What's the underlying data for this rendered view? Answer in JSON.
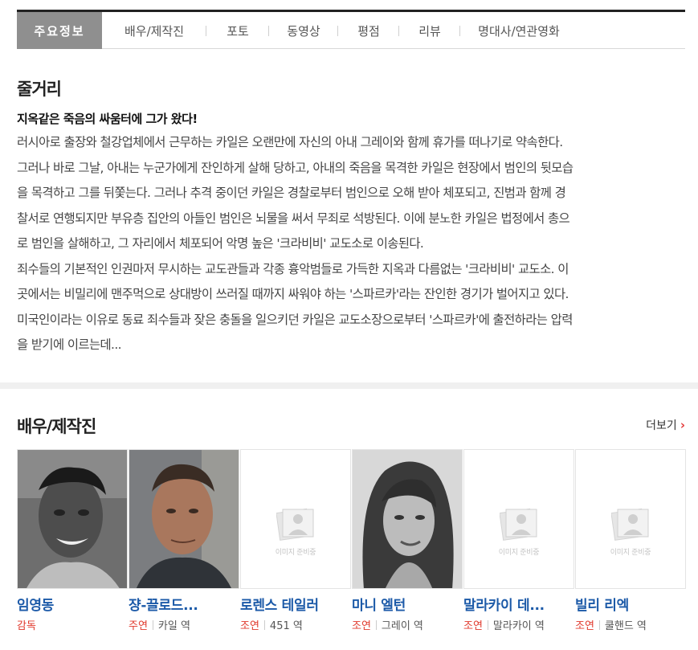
{
  "tabs": [
    {
      "label": "주요정보",
      "active": true
    },
    {
      "label": "배우/제작진"
    },
    {
      "label": "포토"
    },
    {
      "label": "동영상"
    },
    {
      "label": "평점"
    },
    {
      "label": "리뷰"
    },
    {
      "label": "명대사/연관영화"
    }
  ],
  "synopsis": {
    "title": "줄거리",
    "headline": "지옥같은 죽음의 싸움터에 그가 왔다!",
    "lines": [
      "러시아로 출장와 철강업체에서 근무하는 카일은 오랜만에 자신의 아내 그레이와 함께 휴가를 떠나기로 약속한다.",
      "그러나 바로 그날, 아내는 누군가에게 잔인하게 살해 당하고, 아내의 죽음을 목격한 카일은 현장에서 범인의 뒷모습",
      "을 목격하고 그를 뒤쫓는다. 그러나 추격 중이던 카일은 경찰로부터 범인으로 오해 받아 체포되고, 진범과 함께 경",
      "찰서로 연행되지만 부유층 집안의 아들인 범인은 뇌물을 써서 무죄로 석방된다. 이에 분노한 카일은 법정에서 총으",
      "로 범인을 살해하고, 그 자리에서 체포되어 악명 높은 '크라비비' 교도소로 이송된다.",
      "  죄수들의 기본적인 인권마저 무시하는 교도관들과 각종 흉악범들로 가득한 지옥과 다름없는 '크라비비' 교도소. 이",
      "곳에서는 비밀리에 맨주먹으로 상대방이 쓰러질 때까지 싸워야 하는 '스파르카'라는 잔인한 경기가 벌어지고 있다.",
      "미국인이라는 이유로 동료 죄수들과 잦은 충돌을 일으키던 카일은 교도소장으로부터 '스파르카'에 출전하라는 압력",
      "을 받기에 이르는데..."
    ]
  },
  "cast_section": {
    "title": "배우/제작진",
    "more_label": "더보기",
    "more_icon": "chevron-right-icon",
    "accent_color": "#e0392c",
    "name_color": "#1c5aa8",
    "no_image_text": "이미지 준비중",
    "people": [
      {
        "name": "임영동",
        "role": "감독",
        "character": "",
        "photo": "photo-bw-man"
      },
      {
        "name": "쟝-끌로드...",
        "role": "주연",
        "character": "카일 역",
        "photo": "photo-man"
      },
      {
        "name": "로렌스 테일러",
        "role": "조연",
        "character": "451 역",
        "photo": "no-image"
      },
      {
        "name": "마니 엘턴",
        "role": "조연",
        "character": "그레이 역",
        "photo": "photo-bw-woman"
      },
      {
        "name": "말라카이 데...",
        "role": "조연",
        "character": "말라카이 역",
        "photo": "no-image"
      },
      {
        "name": "빌리 리엑",
        "role": "조연",
        "character": "쿨핸드 역",
        "photo": "no-image"
      }
    ]
  }
}
